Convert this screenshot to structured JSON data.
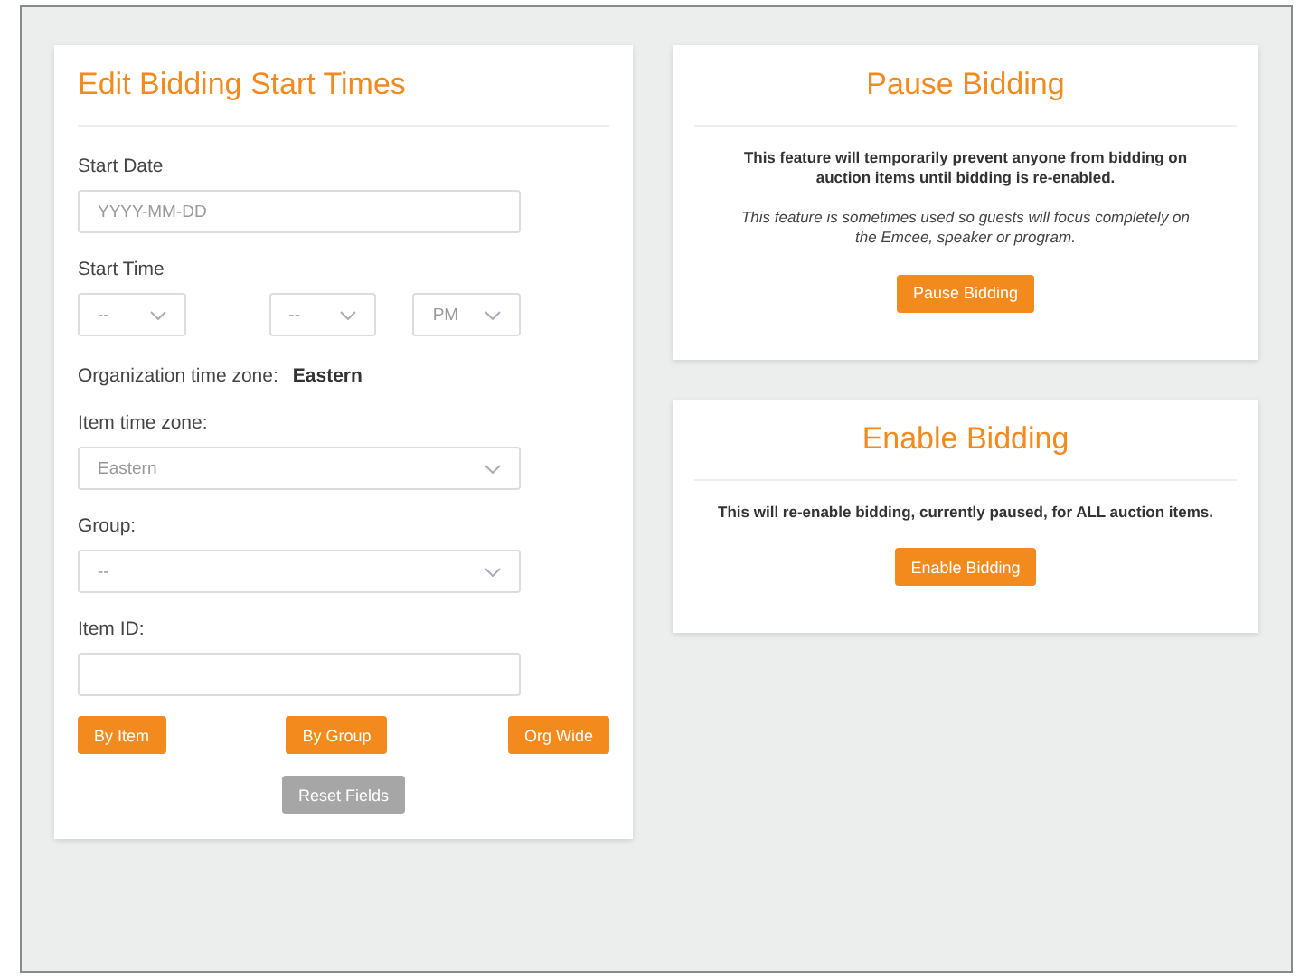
{
  "edit_panel": {
    "title": "Edit Bidding Start Times",
    "fields": [
      {
        "kind": "text",
        "label": "Start Date",
        "placeholder": "YYYY-MM-DD"
      },
      {
        "kind": "time",
        "label": "Start Time",
        "selects": [
          "--",
          "--",
          "PM"
        ]
      },
      {
        "kind": "info",
        "label": "Organization time zone:",
        "value": "Eastern"
      },
      {
        "kind": "select",
        "label": "Item time zone:",
        "value": "Eastern"
      },
      {
        "kind": "select",
        "label": "Group:",
        "value": "--"
      },
      {
        "kind": "text",
        "label": "Item ID:"
      }
    ],
    "buttons": [
      {
        "label": "By Item",
        "disabled": false
      },
      {
        "label": "By Group",
        "disabled": false
      },
      {
        "label": "Org Wide",
        "disabled": false
      }
    ],
    "reset_button": {
      "label": "Reset Fields",
      "disabled": true
    }
  },
  "side_panels": [
    {
      "title": "Pause Bidding",
      "text": "This feature will temporarily prevent anyone from bidding on auction items until bidding is re-enabled.",
      "note": "This feature is sometimes used so guests will focus completely on the Emcee, speaker or program.",
      "button": "Pause Bidding"
    },
    {
      "title": "Enable Bidding",
      "text": "This will re-enable bidding, currently paused, for ALL auction items.",
      "button": "Enable Bidding"
    }
  ]
}
